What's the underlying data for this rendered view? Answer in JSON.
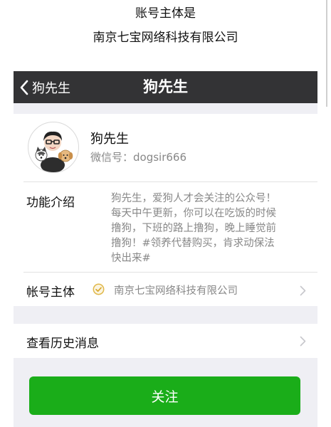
{
  "caption": {
    "line1": "账号主体是",
    "line2": "南京七宝网络科技有限公司"
  },
  "navbar": {
    "back_label": "狗先生",
    "title": "狗先生",
    "background": "#333335"
  },
  "profile": {
    "name": "狗先生",
    "wechat_id": "微信号：dogsir666"
  },
  "intro": {
    "label": "功能介绍",
    "lines": [
      "狗先生，爱狗人才会关注的公众号！",
      "每天中午更新，你可以在吃饭的时候",
      "撸狗，下班的路上撸狗，晚上睡觉前",
      "撸狗！#领养代替购买，肯求动保法",
      "快出来#"
    ]
  },
  "account_subject": {
    "label": "帐号主体",
    "value": "南京七宝网络科技有限公司",
    "icon": "verified-check-icon"
  },
  "history": {
    "label": "查看历史消息"
  },
  "follow_button": {
    "label": "关注",
    "color": "#1aad19"
  }
}
